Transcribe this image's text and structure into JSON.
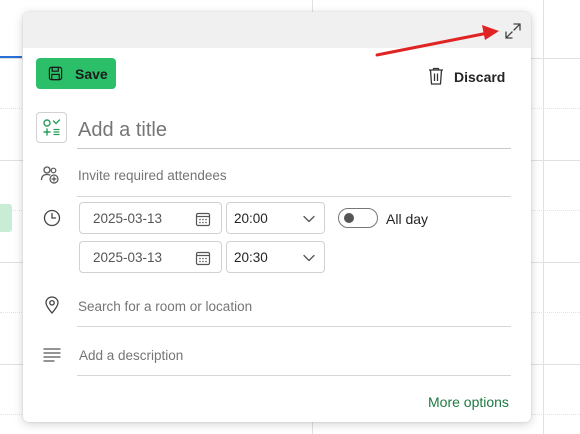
{
  "colors": {
    "save_button_bg": "#2bbf6a",
    "more_options_link": "#1d7a42",
    "annotation_arrow": "#e02424",
    "header_bar": "#f0f0f0"
  },
  "header": {
    "expand_icon": "expand-diagonal-icon"
  },
  "toolbar": {
    "save_label": "Save",
    "save_icon": "save-disk-icon",
    "discard_label": "Discard",
    "discard_icon": "trash-icon"
  },
  "title": {
    "placeholder": "Add a title",
    "icon": "category-icon"
  },
  "attendees": {
    "placeholder": "Invite required attendees",
    "icon": "people-add-icon"
  },
  "time": {
    "icon": "clock-icon",
    "start_date": "2025-03-13",
    "start_time": "20:00",
    "end_date": "2025-03-13",
    "end_time": "20:30",
    "all_day_label": "All day",
    "all_day_on": false
  },
  "location": {
    "placeholder": "Search for a room or location",
    "icon": "location-pin-icon"
  },
  "description": {
    "placeholder": "Add a description",
    "icon": "text-lines-icon"
  },
  "footer": {
    "more_options_label": "More options"
  }
}
